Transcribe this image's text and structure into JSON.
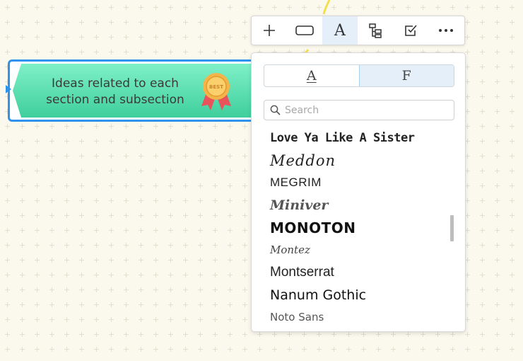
{
  "node": {
    "text_line1": "Ideas related to each",
    "text_line2": "section and subsection",
    "badge_icon": "ribbon-medal-icon",
    "badge_text": "BEST",
    "fill_top": "#7ff0c8",
    "fill_bottom": "#3fcf9c",
    "border_color": "#2f93ec"
  },
  "toolbar": {
    "items": [
      {
        "icon": "plus-icon",
        "active": false
      },
      {
        "icon": "shape-rectangle-icon",
        "active": false
      },
      {
        "icon": "text-font-icon",
        "label": "A",
        "active": true
      },
      {
        "icon": "tree-structure-icon",
        "active": false
      },
      {
        "icon": "checkbox-icon",
        "active": false
      },
      {
        "icon": "more-icon",
        "active": false
      }
    ]
  },
  "panel": {
    "segment_left": "A",
    "segment_right": "F",
    "selected_segment": "F",
    "search_placeholder": "Search",
    "search_value": "",
    "fonts": [
      "Love Ya Like A Sister",
      "Meddon",
      "Megrim",
      "Miniver",
      "Monoton",
      "Montez",
      "Montserrat",
      "Nanum Gothic",
      "Noto Sans"
    ]
  },
  "colors": {
    "accent": "#2f93ec",
    "selected_bg": "#e4effa",
    "canvas_bg": "#fbf8ee"
  }
}
